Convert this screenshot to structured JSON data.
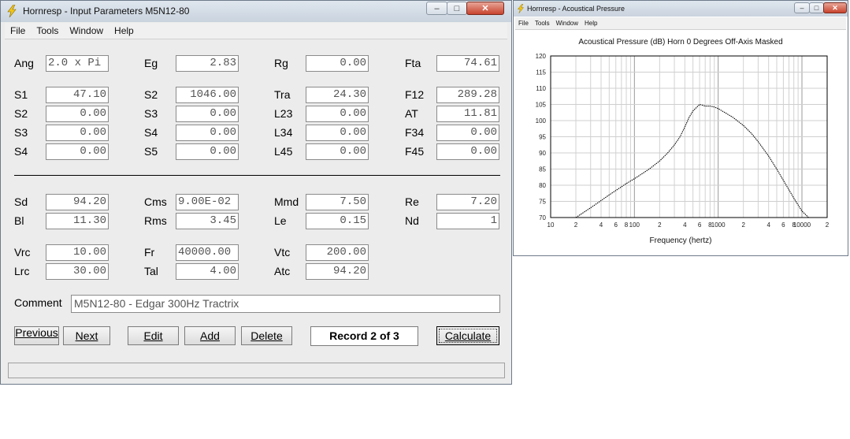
{
  "main_window": {
    "title": "Hornresp - Input Parameters   M5N12-80",
    "menu": [
      "File",
      "Tools",
      "Window",
      "Help"
    ],
    "params": {
      "ang": {
        "label": "Ang",
        "value": "2.0 x Pi"
      },
      "eg": {
        "label": "Eg",
        "value": "2.83"
      },
      "rg": {
        "label": "Rg",
        "value": "0.00"
      },
      "fta": {
        "label": "Fta",
        "value": "74.61"
      },
      "s1a": {
        "label": "S1",
        "value": "47.10"
      },
      "s2a": {
        "label": "S2",
        "value": "1046.00"
      },
      "tra": {
        "label": "Tra",
        "value": "24.30"
      },
      "f12": {
        "label": "F12",
        "value": "289.28"
      },
      "s2b": {
        "label": "S2",
        "value": "0.00"
      },
      "s3a": {
        "label": "S3",
        "value": "0.00"
      },
      "l23": {
        "label": "L23",
        "value": "0.00"
      },
      "at": {
        "label": "AT",
        "value": "11.81"
      },
      "s3b": {
        "label": "S3",
        "value": "0.00"
      },
      "s4a": {
        "label": "S4",
        "value": "0.00"
      },
      "l34": {
        "label": "L34",
        "value": "0.00"
      },
      "f34": {
        "label": "F34",
        "value": "0.00"
      },
      "s4b": {
        "label": "S4",
        "value": "0.00"
      },
      "s5": {
        "label": "S5",
        "value": "0.00"
      },
      "l45": {
        "label": "L45",
        "value": "0.00"
      },
      "f45": {
        "label": "F45",
        "value": "0.00"
      },
      "sd": {
        "label": "Sd",
        "value": "94.20"
      },
      "cms": {
        "label": "Cms",
        "value": "9.00E-02"
      },
      "mmd": {
        "label": "Mmd",
        "value": "7.50"
      },
      "re": {
        "label": "Re",
        "value": "7.20"
      },
      "bl": {
        "label": "Bl",
        "value": "11.30"
      },
      "rms": {
        "label": "Rms",
        "value": "3.45"
      },
      "le": {
        "label": "Le",
        "value": "0.15"
      },
      "nd": {
        "label": "Nd",
        "value": "1"
      },
      "vrc": {
        "label": "Vrc",
        "value": "10.00"
      },
      "fr": {
        "label": "Fr",
        "value": "40000.00"
      },
      "vtc": {
        "label": "Vtc",
        "value": "200.00"
      },
      "lrc": {
        "label": "Lrc",
        "value": "30.00"
      },
      "tal": {
        "label": "Tal",
        "value": "4.00"
      },
      "atc": {
        "label": "Atc",
        "value": "94.20"
      }
    },
    "comment": {
      "label": "Comment",
      "value": "M5N12-80 - Edgar 300Hz Tractrix"
    },
    "buttons": {
      "previous": "Previous",
      "next": "Next",
      "edit": "Edit",
      "add": "Add",
      "delete": "Delete",
      "calculate": "Calculate"
    },
    "record": "Record 2 of 3"
  },
  "plot_window": {
    "title": "Hornresp - Acoustical Pressure",
    "menu": [
      "File",
      "Tools",
      "Window",
      "Help"
    ],
    "chart_data": {
      "type": "line",
      "title": "Acoustical Pressure (dB)   Horn   0 Degrees Off-Axis   Masked",
      "xlabel": "Frequency (hertz)",
      "ylabel": "",
      "x_scale": "log",
      "xlim": [
        10,
        20000
      ],
      "ylim": [
        70,
        120
      ],
      "y_ticks": [
        70,
        75,
        80,
        85,
        90,
        95,
        100,
        105,
        110,
        115,
        120
      ],
      "x_tick_labels": [
        {
          "x": 10,
          "label": "10"
        },
        {
          "x": 20,
          "label": "2"
        },
        {
          "x": 40,
          "label": "4"
        },
        {
          "x": 60,
          "label": "6"
        },
        {
          "x": 80,
          "label": "8"
        },
        {
          "x": 100,
          "label": "100"
        },
        {
          "x": 200,
          "label": "2"
        },
        {
          "x": 400,
          "label": "4"
        },
        {
          "x": 600,
          "label": "6"
        },
        {
          "x": 800,
          "label": "8"
        },
        {
          "x": 1000,
          "label": "1000"
        },
        {
          "x": 2000,
          "label": "2"
        },
        {
          "x": 4000,
          "label": "4"
        },
        {
          "x": 6000,
          "label": "6"
        },
        {
          "x": 8000,
          "label": "8"
        },
        {
          "x": 10000,
          "label": "10000"
        },
        {
          "x": 20000,
          "label": "2"
        }
      ],
      "grid": true,
      "series": [
        {
          "line_style": "dotted",
          "color": "#000000",
          "x": [
            20,
            30,
            50,
            80,
            100,
            150,
            200,
            250,
            300,
            350,
            400,
            450,
            500,
            600,
            700,
            800,
            900,
            1000,
            1200,
            1500,
            2000,
            2500,
            3000,
            4000,
            5000,
            6000,
            8000,
            10000,
            12000
          ],
          "y": [
            70,
            73,
            77,
            80.5,
            82,
            85,
            87.5,
            90,
            92.5,
            95,
            98,
            101,
            103,
            105,
            104.5,
            104.5,
            104.2,
            103.7,
            102.5,
            101,
            98.5,
            96,
            93.5,
            89,
            85,
            81.5,
            76,
            72,
            70
          ]
        }
      ]
    }
  }
}
